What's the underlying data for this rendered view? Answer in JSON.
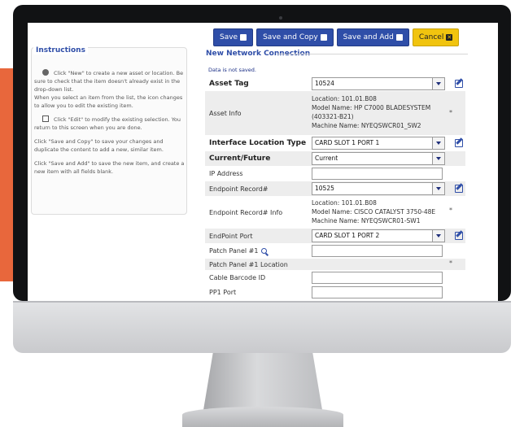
{
  "toolbar": {
    "save": "Save",
    "save_copy": "Save and Copy",
    "save_add": "Save and Add",
    "cancel": "Cancel"
  },
  "instructions": {
    "title": "Instructions",
    "p1": "Click \"New\" to create a new asset or location. Be sure to check that the item doesn't already exist in the drop-down list.",
    "p1b": "When you select an item from the list, the icon changes to allow you to edit the existing item.",
    "p2": "Click \"Edit\" to modify the existing selection. You return to this screen when you are done.",
    "p3": "Click \"Save and Copy\" to save your changes and duplicate the content to add a new, similar item.",
    "p4": "Click \"Save and Add\" to save the new item, and create a new item with all fields blank."
  },
  "form": {
    "title": "New Network Connection",
    "status": "Data is not saved.",
    "asset_tag_label": "Asset Tag",
    "asset_tag_value": "10524",
    "asset_info_label": "Asset Info",
    "asset_info_lines": [
      "Location: 101.01.B08",
      "Model Name: HP C7000 BLADESYSTEM",
      "(403321-B21)",
      "Machine Name: NYEQSWCR01_SW2"
    ],
    "interface_label": "Interface Location Type",
    "interface_value": "CARD SLOT 1 PORT 1",
    "current_future_label": "Current/Future",
    "current_future_value": "Current",
    "ip_label": "IP Address",
    "endpoint_record_label": "Endpoint Record#",
    "endpoint_record_value": "10525",
    "endpoint_info_label": "Endpoint Record# Info",
    "endpoint_info_lines": [
      "Location: 101.01.B08",
      "Model Name: CISCO CATALYST 3750-48E",
      "Machine Name: NYEQSWCR01-SW1"
    ],
    "endpoint_port_label": "EndPoint Port",
    "endpoint_port_value": "CARD SLOT 1 PORT 2",
    "patch_panel_label": "Patch Panel #1",
    "patch_panel_location_label": "Patch Panel #1 Location",
    "cable_barcode_label": "Cable Barcode ID",
    "pp1_port_label": "PP1 Port",
    "required_marker": "*"
  }
}
